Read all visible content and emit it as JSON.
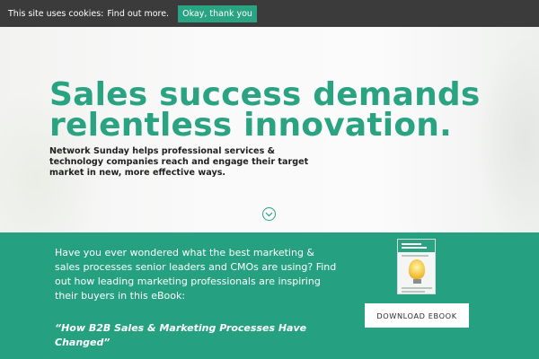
{
  "cookie_bar": {
    "message": "This site uses cookies:",
    "link": "Find out more.",
    "accept_label": "Okay, thank you"
  },
  "hero": {
    "title": "Sales success demands relentless innovation.",
    "subtitle": "Network Sunday helps professional services & technology companies reach and engage their target market in new, more effective ways.",
    "scroll_icon": "chevron-down-icon"
  },
  "promo": {
    "text": "Have you ever wondered what the best marketing & sales processes senior leaders and CMOs are using? Find out how leading marketing professionals are inspiring their buyers in this eBook:",
    "quote": "“How B2B Sales & Marketing Processes Have Changed”",
    "download_label": "DOWNLOAD EBOOK"
  },
  "colors": {
    "accent": "#2aa382",
    "promo_background": "#25a080",
    "cookie_bar_background": "#3b3b3b"
  }
}
